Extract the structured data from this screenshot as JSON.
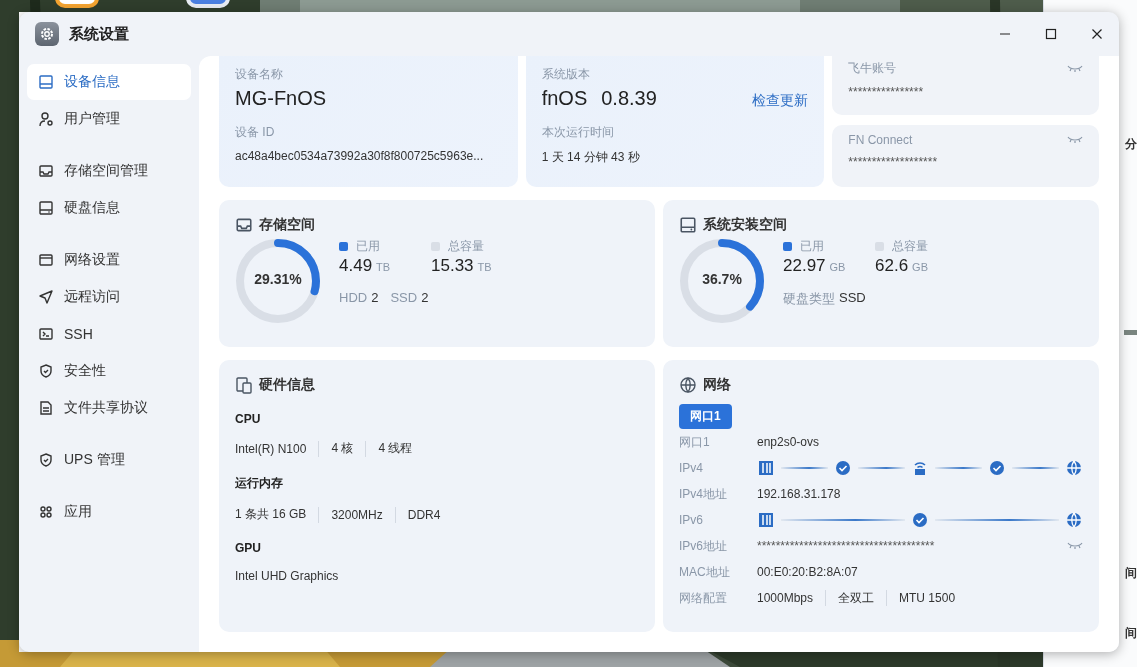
{
  "window": {
    "title": "系统设置"
  },
  "sidebar": {
    "groups": [
      [
        {
          "label": "设备信息",
          "selected": true
        },
        {
          "label": "用户管理",
          "selected": false
        }
      ],
      [
        {
          "label": "存储空间管理",
          "selected": false
        },
        {
          "label": "硬盘信息",
          "selected": false
        }
      ],
      [
        {
          "label": "网络设置",
          "selected": false
        },
        {
          "label": "远程访问",
          "selected": false
        },
        {
          "label": "SSH",
          "selected": false
        },
        {
          "label": "安全性",
          "selected": false
        },
        {
          "label": "文件共享协议",
          "selected": false
        }
      ],
      [
        {
          "label": "UPS 管理",
          "selected": false
        }
      ],
      [
        {
          "label": "应用",
          "selected": false
        }
      ]
    ]
  },
  "device": {
    "name_label": "设备名称",
    "name": "MG-FnOS",
    "id_label": "设备 ID",
    "id": "ac48a4bec0534a73992a30f8f800725c5963e..."
  },
  "system": {
    "version_label": "系统版本",
    "os": "fnOS",
    "version": "0.8.39",
    "check_update": "检查更新",
    "uptime_label": "本次运行时间",
    "uptime": "1 天 14 分钟 43 秒"
  },
  "secrets": [
    {
      "label": "飞牛账号",
      "value": "****************"
    },
    {
      "label": "FN Connect",
      "value": "*******************"
    }
  ],
  "storage_cards": [
    {
      "title": "存储空间",
      "level": 0.2931,
      "percent": "29.31%",
      "used_label": "已用",
      "used": "4.49",
      "used_unit": "TB",
      "total_label": "总容量",
      "total": "15.33",
      "total_unit": "TB",
      "details": [
        {
          "label": "HDD",
          "value": "2"
        },
        {
          "label": "SSD",
          "value": "2"
        }
      ]
    },
    {
      "title": "系统安装空间",
      "level": 0.367,
      "percent": "36.7%",
      "used_label": "已用",
      "used": "22.97",
      "used_unit": "GB",
      "total_label": "总容量",
      "total": "62.6",
      "total_unit": "GB",
      "details": [
        {
          "label": "硬盘类型",
          "value": "SSD"
        }
      ]
    }
  ],
  "hardware": {
    "title": "硬件信息",
    "sections": [
      {
        "heading": "CPU",
        "values": [
          "Intel(R) N100",
          "4 核",
          "4 线程"
        ]
      },
      {
        "heading": "运行内存",
        "values": [
          "1 条共 16 GB",
          "3200MHz",
          "DDR4"
        ]
      },
      {
        "heading": "GPU",
        "values": [
          "Intel UHD Graphics"
        ]
      }
    ]
  },
  "network": {
    "title": "网络",
    "tabs": [
      {
        "label": "网口1",
        "selected": true
      }
    ],
    "rows": [
      {
        "kind": "text",
        "label": "网口1",
        "value": "enp2s0-ovs"
      },
      {
        "kind": "path",
        "label": "IPv4",
        "nodes": [
          {
            "kind": "server"
          },
          {
            "kind": "check"
          },
          {
            "kind": "router"
          },
          {
            "kind": "check"
          },
          {
            "kind": "globe"
          }
        ]
      },
      {
        "kind": "text",
        "label": "IPv4地址",
        "value": "192.168.31.178"
      },
      {
        "kind": "path",
        "label": "IPv6",
        "nodes": [
          {
            "kind": "server"
          },
          {
            "kind": "check"
          },
          {
            "kind": "globe"
          }
        ]
      },
      {
        "kind": "secret",
        "label": "IPv6地址",
        "value": "**************************************"
      },
      {
        "kind": "text",
        "label": "MAC地址",
        "value": "00:E0:20:B2:8A:07"
      },
      {
        "kind": "list",
        "label": "网络配置",
        "values": [
          "1000Mbps",
          "全双工",
          "MTU 1500"
        ]
      }
    ]
  },
  "background_window": {
    "texts": [
      "分",
      "间",
      "间"
    ]
  }
}
